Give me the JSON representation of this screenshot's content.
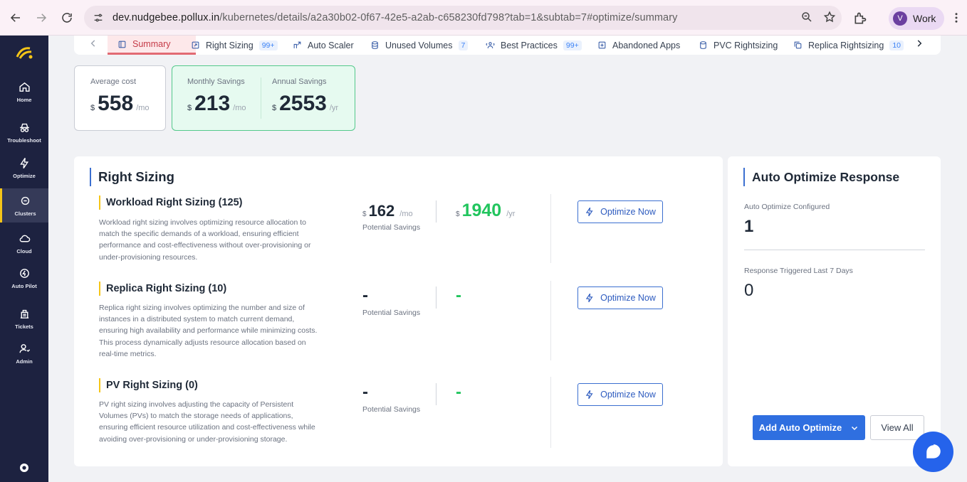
{
  "browser": {
    "url_host": "dev.nudgebee.pollux.in",
    "url_path": "/kubernetes/details/a2a30b02-0f67-42e5-a2ab-c658230fd798?tab=1&subtab=7#optimize/summary",
    "profile_initial": "V",
    "profile_label": "Work"
  },
  "sidebar": {
    "items": [
      {
        "label": "Home",
        "icon": "home-icon"
      },
      {
        "label": "Troubleshoot",
        "icon": "spy-icon"
      },
      {
        "label": "Optimize",
        "icon": "bolt-icon"
      },
      {
        "label": "Clusters",
        "icon": "cluster-icon",
        "active": true
      },
      {
        "label": "Cloud",
        "icon": "cloud-icon"
      },
      {
        "label": "Auto Pilot",
        "icon": "autopilot-icon"
      },
      {
        "label": "Tickets",
        "icon": "tickets-icon"
      },
      {
        "label": "Admin",
        "icon": "admin-icon"
      }
    ]
  },
  "tabs": [
    {
      "label": "Summary",
      "badge": ""
    },
    {
      "label": "Right Sizing",
      "badge": "99+"
    },
    {
      "label": "Auto Scaler",
      "badge": ""
    },
    {
      "label": "Unused Volumes",
      "badge": "7"
    },
    {
      "label": "Best Practices",
      "badge": "99+"
    },
    {
      "label": "Abandoned Apps",
      "badge": ""
    },
    {
      "label": "PVC Rightsizing",
      "badge": ""
    },
    {
      "label": "Replica Rightsizing",
      "badge": "10"
    }
  ],
  "summary": {
    "average_cost": {
      "label": "Average cost",
      "currency": "$",
      "value": "558",
      "unit": "/mo"
    },
    "monthly_savings": {
      "label": "Monthly Savings",
      "currency": "$",
      "value": "213",
      "unit": "/mo"
    },
    "annual_savings": {
      "label": "Annual Savings",
      "currency": "$",
      "value": "2553",
      "unit": "/yr"
    }
  },
  "right_sizing": {
    "title": "Right Sizing",
    "potential_label": "Potential Savings",
    "button_label": "Optimize Now",
    "rows": [
      {
        "title": "Workload Right Sizing (125)",
        "desc": "Workload right sizing involves optimizing resource allocation to match the specific demands of a workload, ensuring efficient performance and cost-effectiveness without over-provisioning or under-provisioning resources.",
        "monthly_currency": "$",
        "monthly": "162",
        "monthly_unit": "/mo",
        "annual_currency": "$",
        "annual": "1940",
        "annual_unit": "/yr"
      },
      {
        "title": "Replica Right Sizing (10)",
        "desc": "Replica right sizing involves optimizing the number and size of instances in a distributed system to match current demand, ensuring high availability and performance while minimizing costs. This process dynamically adjusts resource allocation based on real-time metrics.",
        "monthly": "-",
        "annual": "-"
      },
      {
        "title": "PV Right Sizing (0)",
        "desc": "PV right sizing involves adjusting the capacity of Persistent Volumes (PVs) to match the storage needs of applications, ensuring efficient resource utilization and cost-effectiveness while avoiding over-provisioning or under-provisioning storage.",
        "monthly": "-",
        "annual": "-"
      }
    ]
  },
  "auto_optimize": {
    "title": "Auto Optimize Response",
    "configured_label": "Auto Optimize Configured",
    "configured_value": "1",
    "triggered_label": "Response Triggered Last 7 Days",
    "triggered_value": "0",
    "add_button": "Add Auto Optimize",
    "view_button": "View All"
  },
  "colors": {
    "sidebar_bg": "#1d2240",
    "accent_blue": "#2f6fe0",
    "savings_green": "#22c55e",
    "active_tab": "#e26a73"
  }
}
